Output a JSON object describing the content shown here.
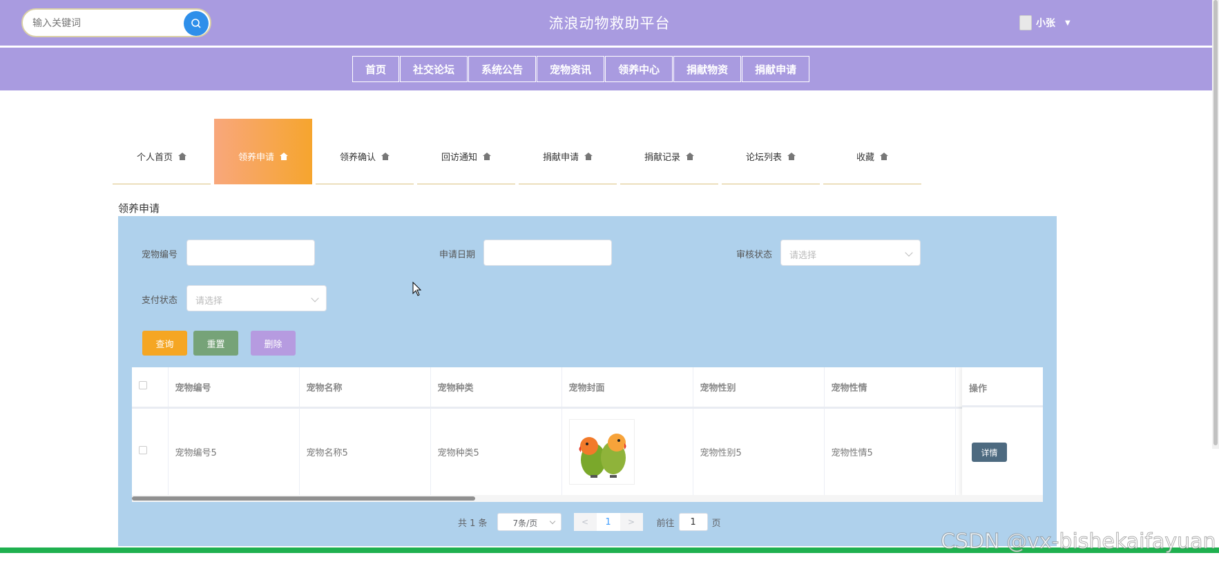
{
  "header": {
    "search_placeholder": "输入关键词",
    "site_title": "流浪动物救助平台",
    "username": "小张"
  },
  "nav": [
    "首页",
    "社交论坛",
    "系统公告",
    "宠物资讯",
    "领养中心",
    "捐献物资",
    "捐献申请"
  ],
  "tabs": [
    {
      "label": "个人首页",
      "active": false
    },
    {
      "label": "领养申请",
      "active": true
    },
    {
      "label": "领养确认",
      "active": false
    },
    {
      "label": "回访通知",
      "active": false
    },
    {
      "label": "捐献申请",
      "active": false
    },
    {
      "label": "捐献记录",
      "active": false
    },
    {
      "label": "论坛列表",
      "active": false
    },
    {
      "label": "收藏",
      "active": false
    }
  ],
  "section_title": "领养申请",
  "filters": {
    "pet_no_label": "宠物编号",
    "apply_date_label": "申请日期",
    "audit_status_label": "审核状态",
    "audit_status_placeholder": "请选择",
    "pay_status_label": "支付状态",
    "pay_status_placeholder": "请选择"
  },
  "buttons": {
    "query": "查询",
    "reset": "重置",
    "delete": "删除",
    "detail": "详情"
  },
  "table": {
    "columns": [
      "宠物编号",
      "宠物名称",
      "宠物种类",
      "宠物封面",
      "宠物性别",
      "宠物性情"
    ],
    "operation_header": "操作",
    "rows": [
      {
        "pet_no": "宠物编号5",
        "pet_name": "宠物名称5",
        "pet_type": "宠物种类5",
        "pet_gender": "宠物性别5",
        "pet_temper": "宠物性情5"
      }
    ]
  },
  "pagination": {
    "total_text": "共 1 条",
    "page_size": "7条/页",
    "current_page": "1",
    "goto_label": "前往",
    "goto_value": "1",
    "page_suffix": "页"
  },
  "watermark": "CSDN @vx-bishekaifayuan",
  "colors": {
    "header_bg": "#a99be0",
    "panel_bg": "#afd1ec",
    "active_tab": "#f6a52e",
    "query_btn": "#f5a623",
    "reset_btn": "#76a378",
    "delete_btn": "#b69be0",
    "footer_bar": "#1fb04f"
  }
}
